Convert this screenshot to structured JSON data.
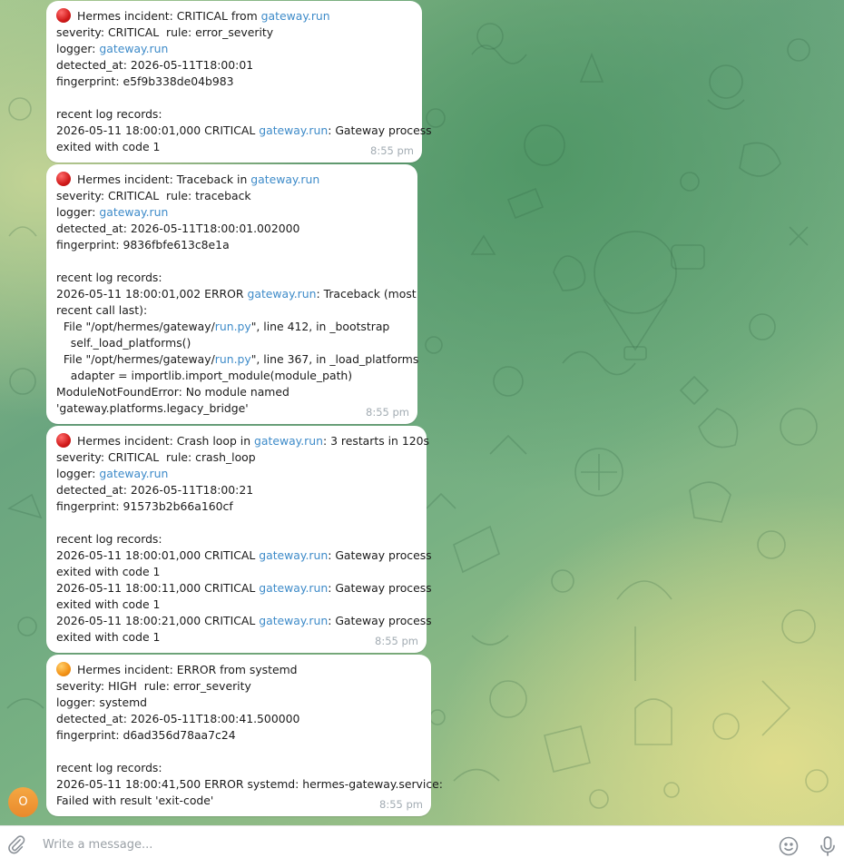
{
  "chat": {
    "avatar_letter": "O",
    "messages": [
      {
        "status": "red",
        "lines": [
          [
            {
              "t": "Hermes incident: CRITICAL from "
            },
            {
              "t": "gateway.run",
              "link": true
            }
          ],
          [
            {
              "t": "severity: CRITICAL  rule: error_severity"
            }
          ],
          [
            {
              "t": "logger: "
            },
            {
              "t": "gateway.run",
              "link": true
            }
          ],
          [
            {
              "t": "detected_at: 2026-05-11T18:00:01"
            }
          ],
          [
            {
              "t": "fingerprint: e5f9b338de04b983"
            }
          ],
          [],
          [
            {
              "t": "recent log records:"
            }
          ],
          [
            {
              "t": "2026-05-11 18:00:01,000 CRITICAL "
            },
            {
              "t": "gateway.run",
              "link": true
            },
            {
              "t": ": Gateway process"
            }
          ],
          [
            {
              "t": "exited with code 1"
            }
          ]
        ],
        "time": "8:55 pm"
      },
      {
        "status": "red",
        "lines": [
          [
            {
              "t": "Hermes incident: Traceback in "
            },
            {
              "t": "gateway.run",
              "link": true
            }
          ],
          [
            {
              "t": "severity: CRITICAL  rule: traceback"
            }
          ],
          [
            {
              "t": "logger: "
            },
            {
              "t": "gateway.run",
              "link": true
            }
          ],
          [
            {
              "t": "detected_at: 2026-05-11T18:00:01.002000"
            }
          ],
          [
            {
              "t": "fingerprint: 9836fbfe613c8e1a"
            }
          ],
          [],
          [
            {
              "t": "recent log records:"
            }
          ],
          [
            {
              "t": "2026-05-11 18:00:01,002 ERROR "
            },
            {
              "t": "gateway.run",
              "link": true
            },
            {
              "t": ": Traceback (most"
            }
          ],
          [
            {
              "t": "recent call last):"
            }
          ],
          [
            {
              "t": "  File \"/opt/hermes/gateway/"
            },
            {
              "t": "run.py",
              "link": true
            },
            {
              "t": "\", line 412, in _bootstrap"
            }
          ],
          [
            {
              "t": "    self._load_platforms()"
            }
          ],
          [
            {
              "t": "  File \"/opt/hermes/gateway/"
            },
            {
              "t": "run.py",
              "link": true
            },
            {
              "t": "\", line 367, in _load_platforms"
            }
          ],
          [
            {
              "t": "    adapter = importlib.import_module(module_path)"
            }
          ],
          [
            {
              "t": "ModuleNotFoundError: No module named"
            }
          ],
          [
            {
              "t": "'gateway.platforms.legacy_bridge'"
            }
          ]
        ],
        "time": "8:55 pm"
      },
      {
        "status": "red",
        "lines": [
          [
            {
              "t": "Hermes incident: Crash loop in "
            },
            {
              "t": "gateway.run",
              "link": true
            },
            {
              "t": ": 3 restarts in 120s"
            }
          ],
          [
            {
              "t": "severity: CRITICAL  rule: crash_loop"
            }
          ],
          [
            {
              "t": "logger: "
            },
            {
              "t": "gateway.run",
              "link": true
            }
          ],
          [
            {
              "t": "detected_at: 2026-05-11T18:00:21"
            }
          ],
          [
            {
              "t": "fingerprint: 91573b2b66a160cf"
            }
          ],
          [],
          [
            {
              "t": "recent log records:"
            }
          ],
          [
            {
              "t": "2026-05-11 18:00:01,000 CRITICAL "
            },
            {
              "t": "gateway.run",
              "link": true
            },
            {
              "t": ": Gateway process"
            }
          ],
          [
            {
              "t": "exited with code 1"
            }
          ],
          [
            {
              "t": "2026-05-11 18:00:11,000 CRITICAL "
            },
            {
              "t": "gateway.run",
              "link": true
            },
            {
              "t": ": Gateway process"
            }
          ],
          [
            {
              "t": "exited with code 1"
            }
          ],
          [
            {
              "t": "2026-05-11 18:00:21,000 CRITICAL "
            },
            {
              "t": "gateway.run",
              "link": true
            },
            {
              "t": ": Gateway process"
            }
          ],
          [
            {
              "t": "exited with code 1"
            }
          ]
        ],
        "time": "8:55 pm"
      },
      {
        "status": "orange",
        "lines": [
          [
            {
              "t": "Hermes incident: ERROR from systemd"
            }
          ],
          [
            {
              "t": "severity: HIGH  rule: error_severity"
            }
          ],
          [
            {
              "t": "logger: systemd"
            }
          ],
          [
            {
              "t": "detected_at: 2026-05-11T18:00:41.500000"
            }
          ],
          [
            {
              "t": "fingerprint: d6ad356d78aa7c24"
            }
          ],
          [],
          [
            {
              "t": "recent log records:"
            }
          ],
          [
            {
              "t": "2026-05-11 18:00:41,500 ERROR systemd: hermes-gateway.service:"
            }
          ],
          [
            {
              "t": "Failed with result 'exit-code'"
            }
          ]
        ],
        "time": "8:55 pm"
      }
    ]
  },
  "composer": {
    "placeholder": "Write a message...",
    "icons": [
      "paperclip-icon",
      "emoji-icon",
      "microphone-icon"
    ]
  },
  "colors": {
    "link": "#3e8bc9",
    "critical_dot": "#d11a1a",
    "high_dot": "#f39216",
    "avatar": "#f0992f"
  }
}
